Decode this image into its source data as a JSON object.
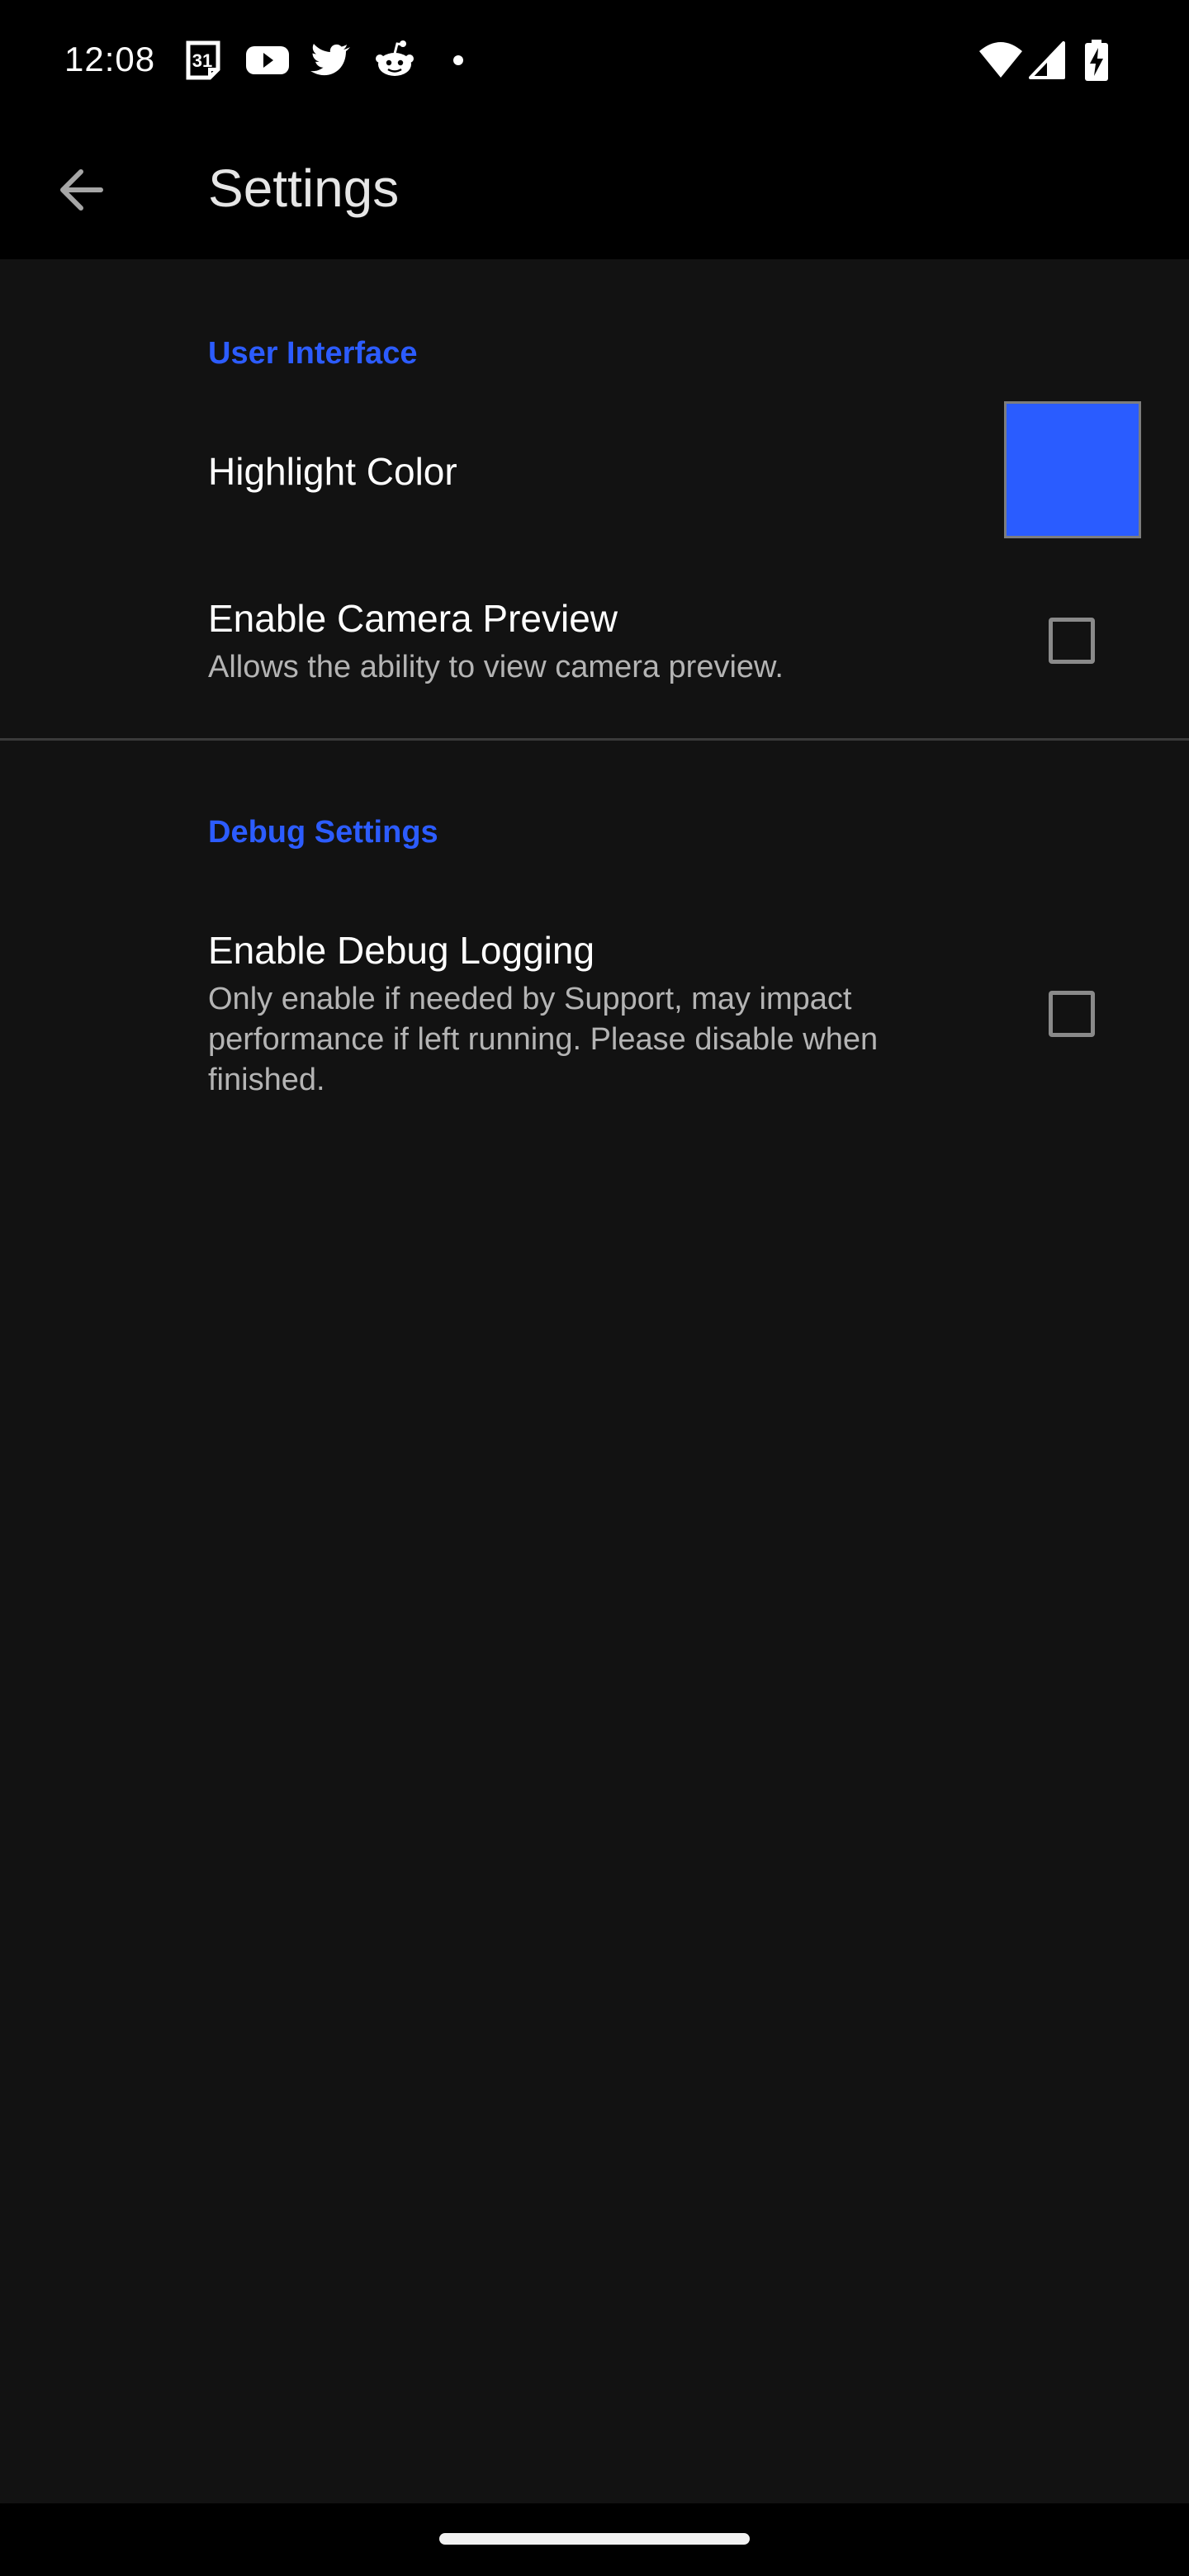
{
  "status_bar": {
    "time": "12:08",
    "left_icons": [
      "calendar-31-icon",
      "youtube-icon",
      "twitter-icon",
      "reddit-icon",
      "notification-dot-icon"
    ],
    "calendar_day": "31",
    "right_icons": [
      "wifi-icon",
      "cell-signal-icon",
      "battery-charging-icon"
    ]
  },
  "app_bar": {
    "back_icon": "arrow-back-icon",
    "title": "Settings"
  },
  "sections": [
    {
      "header": "User Interface",
      "items": [
        {
          "title": "Highlight Color",
          "widget": "color-swatch",
          "color": "#2a5cff"
        },
        {
          "title": "Enable Camera Preview",
          "summary": "Allows the ability to view camera preview.",
          "widget": "checkbox",
          "checked": false
        }
      ]
    },
    {
      "header": "Debug Settings",
      "items": [
        {
          "title": "Enable Debug Logging",
          "summary": "Only enable if needed by Support, may impact performance if left running. Please disable when finished.",
          "widget": "checkbox",
          "checked": false
        }
      ]
    }
  ],
  "theme": {
    "accent": "#2c5cff",
    "background": "#121212",
    "bar_background": "#000000"
  }
}
